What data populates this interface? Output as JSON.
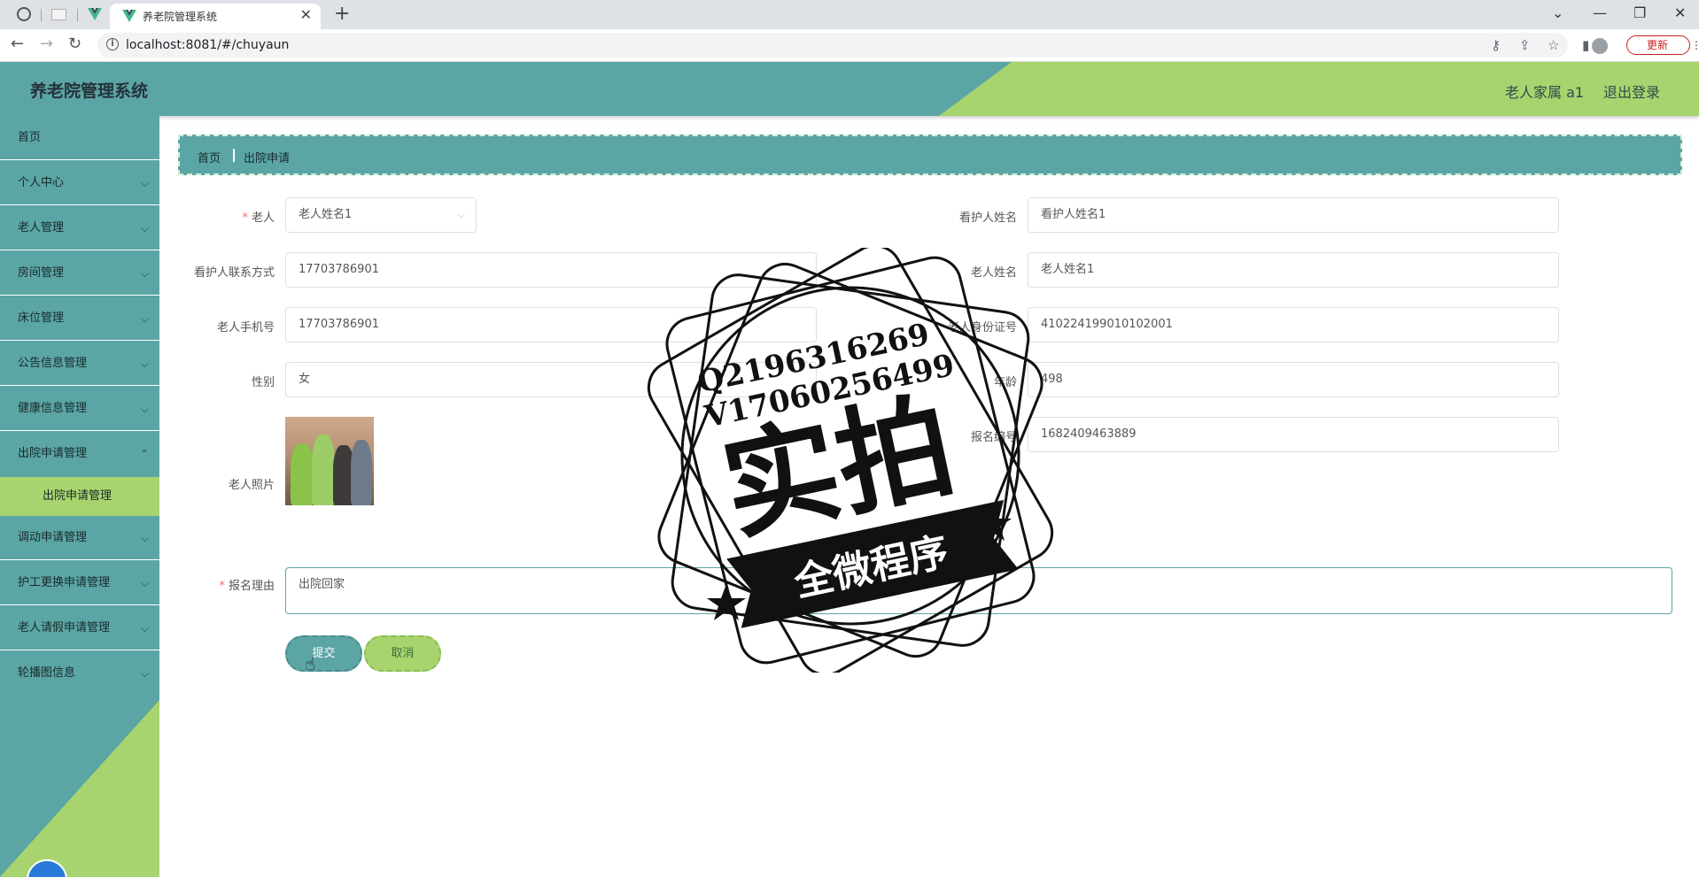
{
  "browser": {
    "tab_title": "养老院管理系统",
    "url": "localhost:8081/#/chuyaun",
    "update_label": "更新"
  },
  "header": {
    "title": "养老院管理系统",
    "user": "老人家属 a1",
    "logout": "退出登录"
  },
  "sidebar": {
    "items": [
      {
        "label": "首页"
      },
      {
        "label": "个人中心"
      },
      {
        "label": "老人管理"
      },
      {
        "label": "房间管理"
      },
      {
        "label": "床位管理"
      },
      {
        "label": "公告信息管理"
      },
      {
        "label": "健康信息管理"
      },
      {
        "label": "出院申请管理"
      },
      {
        "label": "调动申请管理"
      },
      {
        "label": "护工更换申请管理"
      },
      {
        "label": "老人请假申请管理"
      },
      {
        "label": "轮播图信息"
      }
    ],
    "active_sub": "出院申请管理"
  },
  "breadcrumb": {
    "home": "首页",
    "current": "出院申请"
  },
  "form": {
    "elder_label": "老人",
    "elder_value": "老人姓名1",
    "caregiver_name_label": "看护人姓名",
    "caregiver_name_value": "看护人姓名1",
    "caregiver_phone_label": "看护人联系方式",
    "caregiver_phone_value": "17703786901",
    "elder_name_label": "老人姓名",
    "elder_name_value": "老人姓名1",
    "elder_phone_label": "老人手机号",
    "elder_phone_value": "17703786901",
    "id_label": "老人身份证号",
    "id_value": "410224199010102001",
    "gender_label": "性别",
    "gender_value": "女",
    "age_label": "年龄",
    "age_value": "498",
    "reg_no_label": "报名编号",
    "reg_no_value": "1682409463889",
    "photo_label": "老人照片",
    "reason_label": "报名理由",
    "reason_value": "出院回家",
    "submit": "提交",
    "cancel": "取消"
  },
  "watermark": {
    "line1": "Q2196316269",
    "line2": "V17060256499",
    "big": "实拍",
    "banner": "全微程序"
  }
}
